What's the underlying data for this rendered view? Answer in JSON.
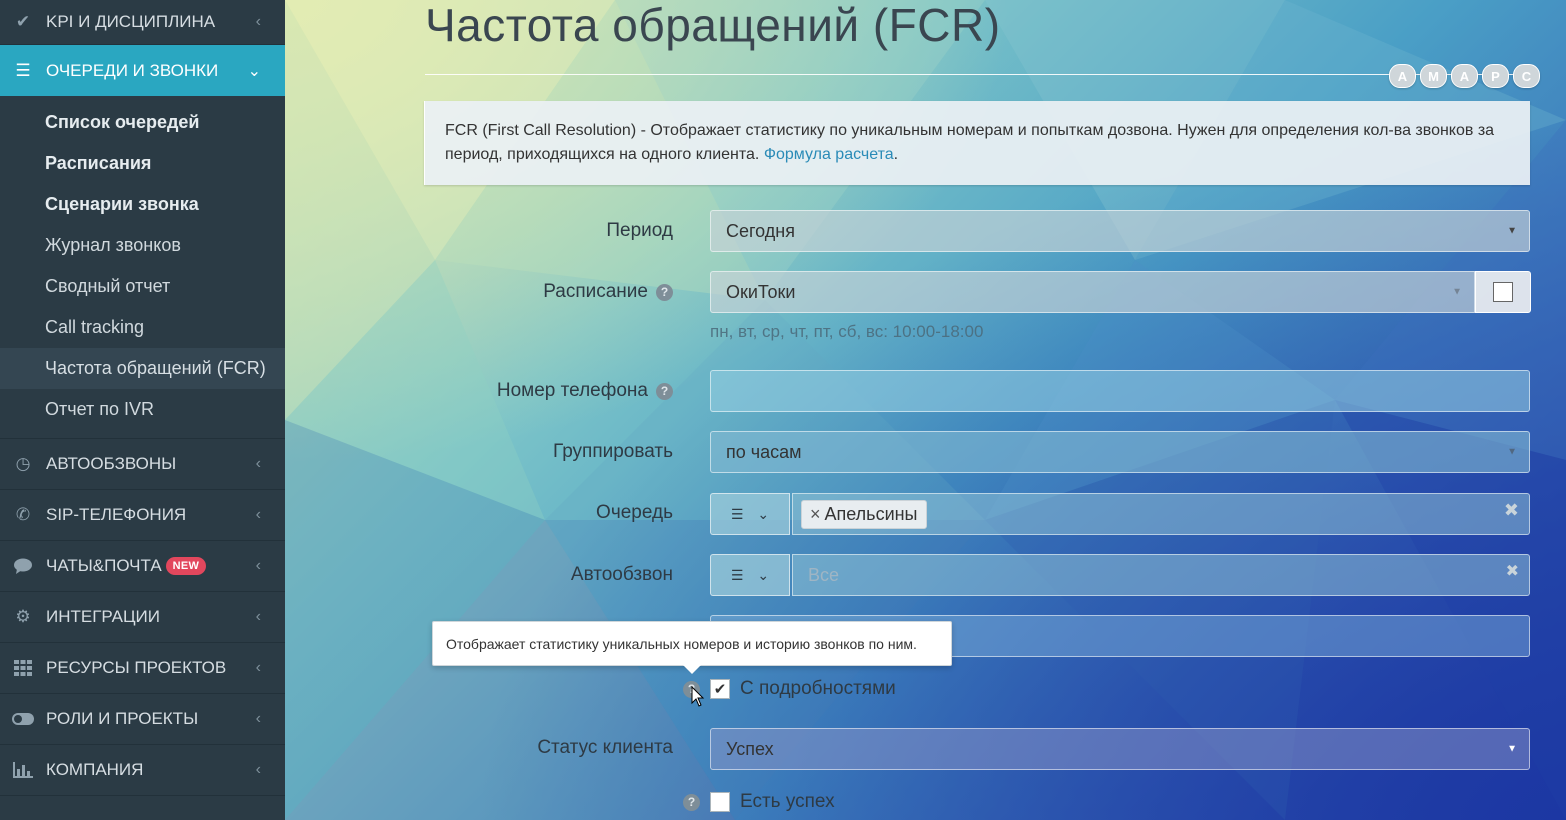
{
  "sidebar": {
    "top_items": [
      {
        "label": "KPI И ДИСЦИПЛИНА",
        "icon": "check-icon"
      },
      {
        "label": "ОЧЕРЕДИ И ЗВОНКИ",
        "icon": "list-icon"
      }
    ],
    "sub_items": [
      {
        "label": "Список очередей"
      },
      {
        "label": "Расписания"
      },
      {
        "label": "Сценарии звонка"
      },
      {
        "label": "Журнал звонков"
      },
      {
        "label": "Сводный отчет"
      },
      {
        "label": "Call tracking"
      },
      {
        "label": "Частота обращений (FCR)"
      },
      {
        "label": "Отчет по IVR"
      }
    ],
    "bottom_items": [
      {
        "label": "АВТООБЗВОНЫ",
        "icon": "clock-icon"
      },
      {
        "label": "SIP-ТЕЛЕФОНИЯ",
        "icon": "phone-icon"
      },
      {
        "label": "ЧАТЫ&ПОЧТА",
        "icon": "chat-icon",
        "badge": "NEW"
      },
      {
        "label": "ИНТЕГРАЦИИ",
        "icon": "gears-icon"
      },
      {
        "label": "РЕСУРСЫ ПРОЕКТОВ",
        "icon": "grid-icon"
      },
      {
        "label": "РОЛИ И ПРОЕКТЫ",
        "icon": "toggle-icon"
      },
      {
        "label": "КОМПАНИЯ",
        "icon": "bar-chart-icon"
      }
    ]
  },
  "main": {
    "title": "Частота обращений (FCR)",
    "letters": [
      "A",
      "M",
      "A",
      "P",
      "C"
    ],
    "info": {
      "text": "FCR (First Call Resolution) - Отображает статистику по уникальным номерам и попыткам дозвона. Нужен для определения кол-ва звонков за период, приходящихся на одного клиента. ",
      "link": "Формула расчета",
      "after": "."
    },
    "form": {
      "period_label": "Период",
      "period_value": "Сегодня",
      "schedule_label": "Расписание",
      "schedule_value": "ОкиТоки",
      "schedule_hint": "пн, вт, ср, чт, пт, сб, вс: 10:00-18:00",
      "phone_label": "Номер телефона",
      "phone_value": "",
      "group_label": "Группировать",
      "group_value": "по часам",
      "queue_label": "Очередь",
      "queue_tag": "Апельсины",
      "autocall_label": "Автообзвон",
      "autocall_placeholder": "Все",
      "details_label": "С подробностями",
      "client_status_label": "Статус клиента",
      "client_status_value": "Успех",
      "has_success_label": "Есть успех"
    },
    "tooltip": "Отображает статистику уникальных номеров и историю звонков по ним."
  }
}
